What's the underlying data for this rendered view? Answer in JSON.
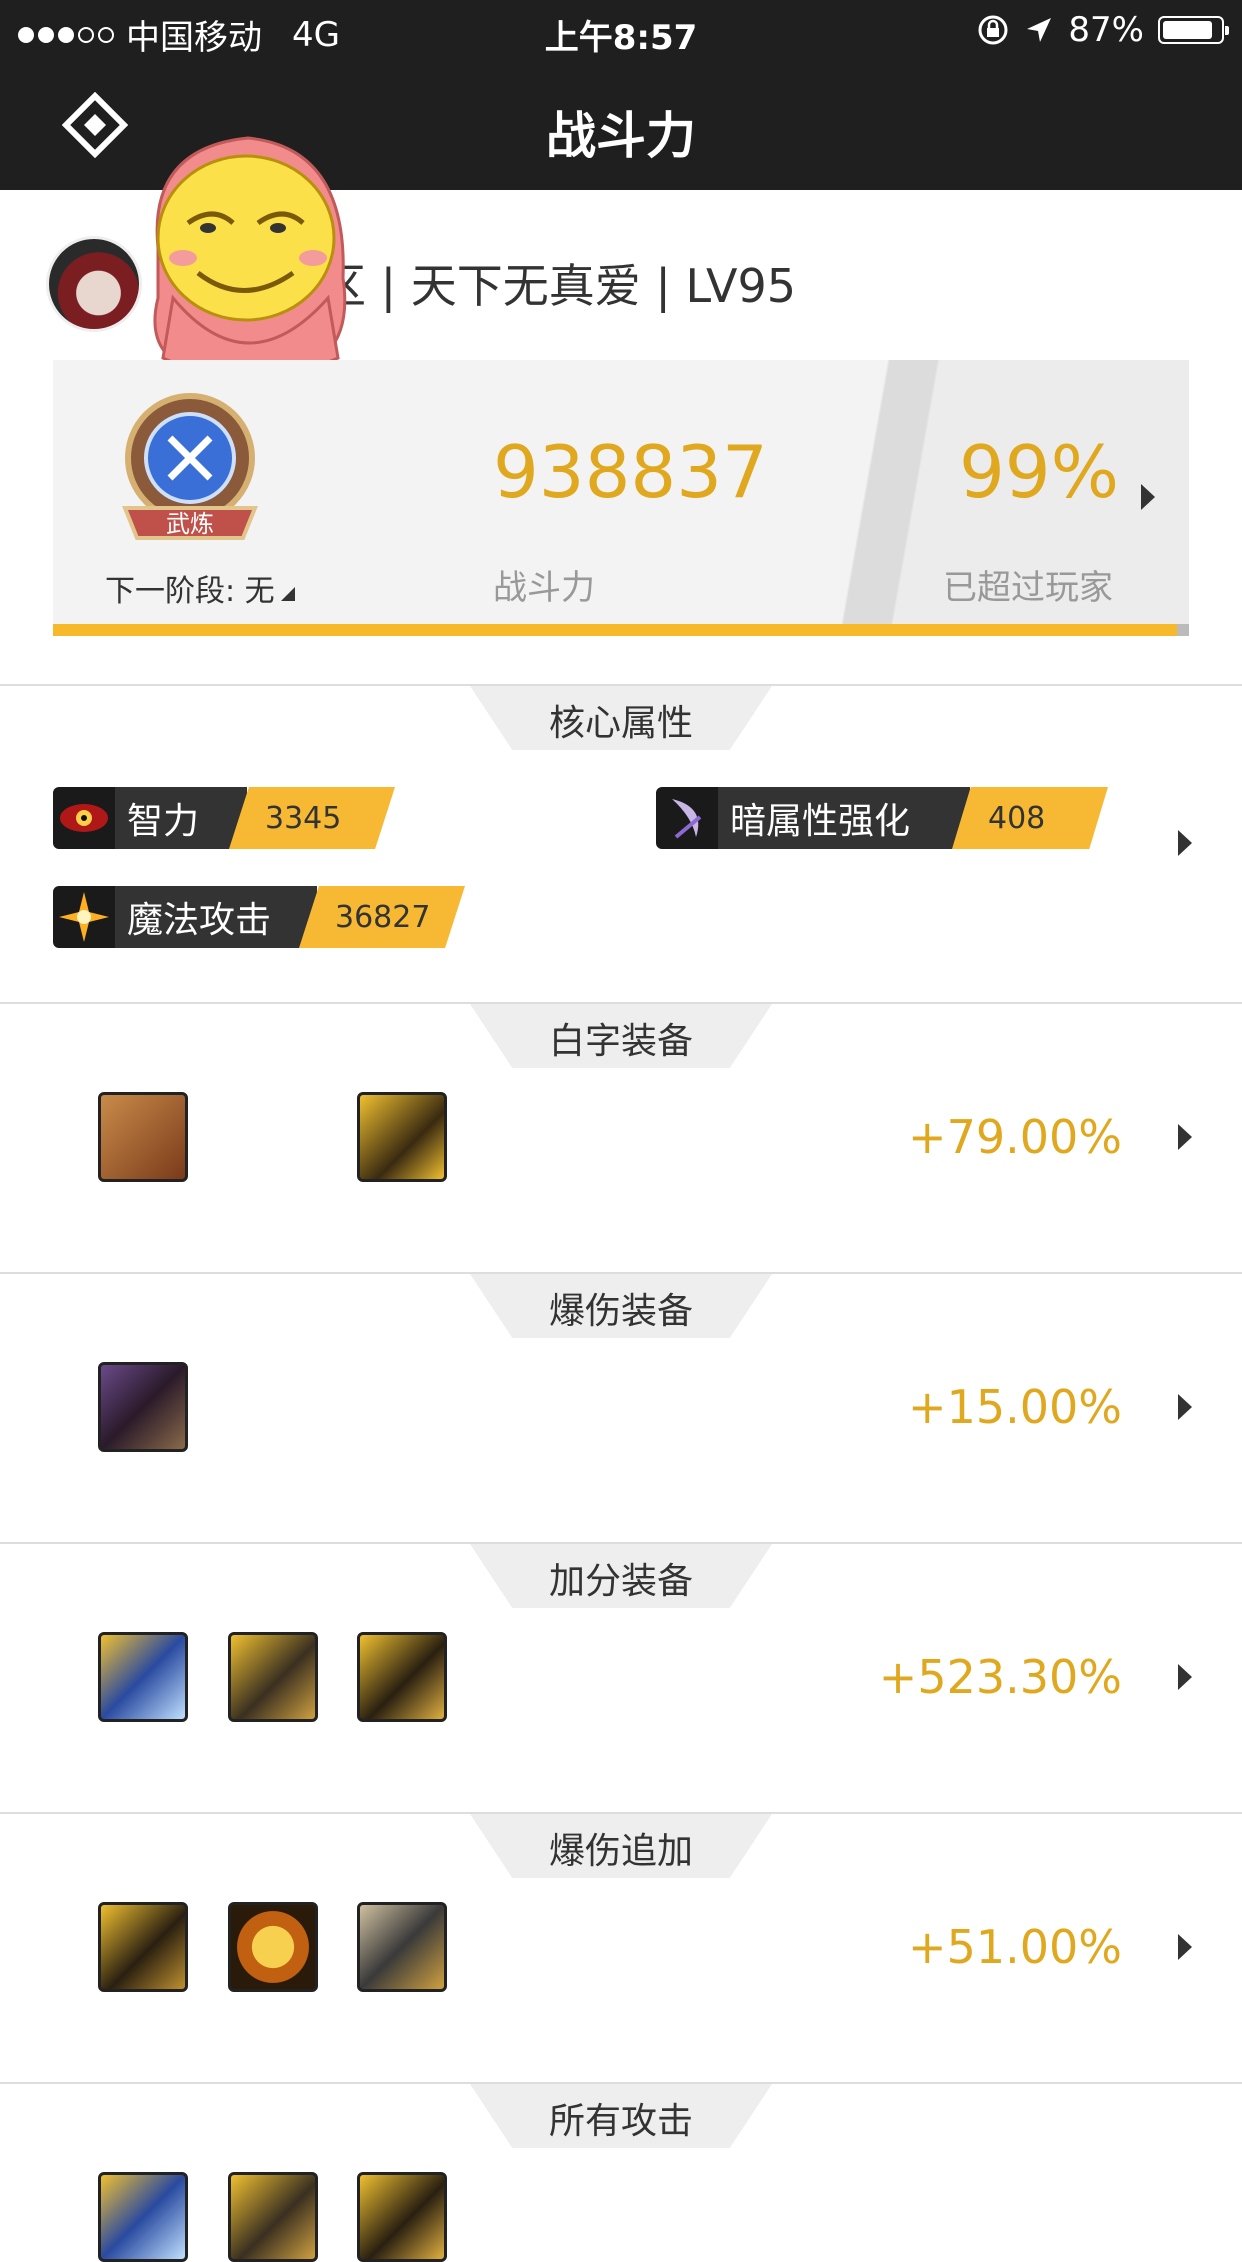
{
  "status_bar": {
    "carrier": "中国移动",
    "network": "4G",
    "time": "上午8:57",
    "battery": "87%",
    "battery_level": 0.87
  },
  "nav": {
    "title": "战斗力"
  },
  "profile": {
    "name": "区 | 天下无真爱 | LV95"
  },
  "power_card": {
    "badge_text": "武炼",
    "next_stage": "下一阶段: 无",
    "power_value": "938837",
    "power_label": "战斗力",
    "percent_value": "99%",
    "percent_label": "已超过玩家",
    "progress": 0.99
  },
  "sections": {
    "core": {
      "title": "核心属性",
      "attributes": [
        {
          "name": "智力",
          "value": "3345",
          "icon": "eye-icon"
        },
        {
          "name": "暗属性强化",
          "value": "408",
          "icon": "dark-scythe-icon"
        },
        {
          "name": "魔法攻击",
          "value": "36827",
          "icon": "magic-burst-icon"
        }
      ]
    },
    "white_equip": {
      "title": "白字装备",
      "value": "+79.00%"
    },
    "crit_equip": {
      "title": "爆伤装备",
      "value": "+15.00%"
    },
    "bonus_equip": {
      "title": "加分装备",
      "value": "+523.30%"
    },
    "crit_add": {
      "title": "爆伤追加",
      "value": "+51.00%"
    },
    "all_attack": {
      "title": "所有攻击"
    }
  },
  "colors": {
    "accent": "#e0a81e",
    "bar": "#1f1f1f",
    "attr_value_bg": "#f7b934"
  }
}
